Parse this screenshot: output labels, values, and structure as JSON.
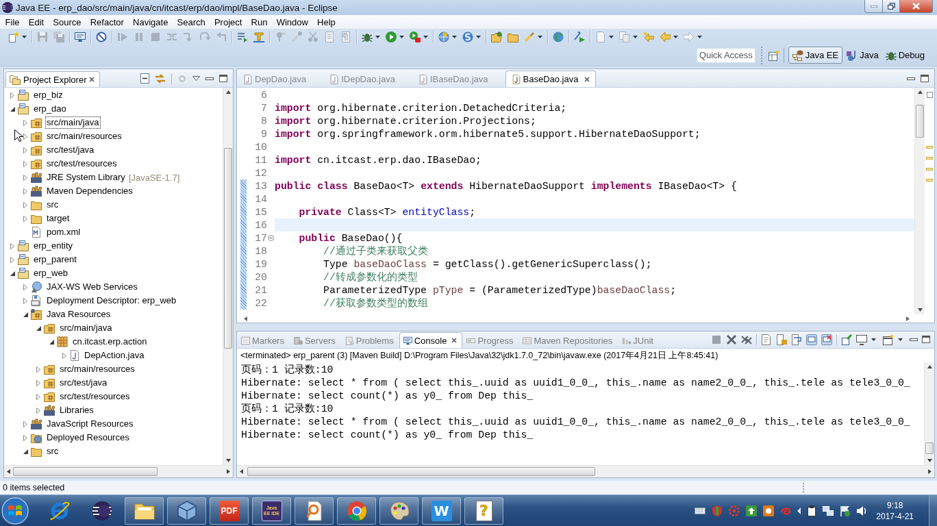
{
  "window": {
    "title": "Java EE - erp_dao/src/main/java/cn/itcast/erp/dao/impl/BaseDao.java - Eclipse"
  },
  "menu": [
    "File",
    "Edit",
    "Source",
    "Refactor",
    "Navigate",
    "Search",
    "Project",
    "Run",
    "Window",
    "Help"
  ],
  "quick_access": {
    "placeholder": "Quick Access"
  },
  "perspectives": [
    {
      "label": "Java EE",
      "kind": "javaee",
      "selected": true
    },
    {
      "label": "Java",
      "kind": "java",
      "selected": false
    },
    {
      "label": "Debug",
      "kind": "debug",
      "selected": false
    }
  ],
  "project_explorer": {
    "title": "Project Explorer",
    "items": [
      {
        "label": "erp_biz",
        "kind": "project",
        "expanded": false,
        "focused": false
      },
      {
        "label": "erp_dao",
        "kind": "project",
        "expanded": true,
        "focused": false,
        "children": [
          {
            "label": "src/main/java",
            "kind": "source_folder",
            "expanded": false,
            "focused": true
          },
          {
            "label": "src/main/resources",
            "kind": "source_folder",
            "expanded": false,
            "focused": false
          },
          {
            "label": "src/test/java",
            "kind": "source_folder",
            "expanded": false,
            "focused": false
          },
          {
            "label": "src/test/resources",
            "kind": "source_folder",
            "expanded": false,
            "focused": false
          },
          {
            "label": "JRE System Library",
            "decoration": "[JavaSE-1.7]",
            "kind": "library",
            "expanded": false,
            "focused": false
          },
          {
            "label": "Maven Dependencies",
            "kind": "library",
            "expanded": false,
            "focused": false
          },
          {
            "label": "src",
            "kind": "folder",
            "expanded": false,
            "focused": false
          },
          {
            "label": "target",
            "kind": "folder",
            "expanded": false,
            "focused": false
          },
          {
            "label": "pom.xml",
            "kind": "xml_file",
            "focused": false
          }
        ]
      },
      {
        "label": "erp_entity",
        "kind": "project",
        "expanded": false,
        "focused": false
      },
      {
        "label": "erp_parent",
        "kind": "project",
        "expanded": false,
        "focused": false
      },
      {
        "label": "erp_web",
        "kind": "project",
        "expanded": true,
        "focused": false,
        "children": [
          {
            "label": "JAX-WS Web Services",
            "kind": "web_services",
            "expanded": false,
            "focused": false
          },
          {
            "label": "Deployment Descriptor: erp_web",
            "kind": "descriptor",
            "expanded": false,
            "focused": false
          },
          {
            "label": "Java Resources",
            "kind": "java_resources",
            "expanded": true,
            "focused": false,
            "children": [
              {
                "label": "src/main/java",
                "kind": "source_folder",
                "expanded": true,
                "focused": false,
                "children": [
                  {
                    "label": "cn.itcast.erp.action",
                    "kind": "package",
                    "expanded": true,
                    "focused": false,
                    "children": [
                      {
                        "label": "DepAction.java",
                        "kind": "java_file",
                        "expanded": false,
                        "focused": false
                      }
                    ]
                  }
                ]
              },
              {
                "label": "src/main/resources",
                "kind": "source_folder",
                "expanded": false,
                "focused": false
              },
              {
                "label": "src/test/java",
                "kind": "source_folder",
                "expanded": false,
                "focused": false
              },
              {
                "label": "src/test/resources",
                "kind": "source_folder",
                "expanded": false,
                "focused": false
              },
              {
                "label": "Libraries",
                "kind": "library",
                "expanded": false,
                "focused": false
              }
            ]
          },
          {
            "label": "JavaScript Resources",
            "kind": "library",
            "expanded": false,
            "focused": false
          },
          {
            "label": "Deployed Resources",
            "kind": "deployed_resources",
            "expanded": false,
            "focused": false
          },
          {
            "label": "src",
            "kind": "folder",
            "expanded": true,
            "focused": false
          }
        ]
      }
    ]
  },
  "editor": {
    "tabs": [
      {
        "label": "DepDao.java",
        "selected": false
      },
      {
        "label": "IDepDao.java",
        "selected": false
      },
      {
        "label": "IBaseDao.java",
        "selected": false
      },
      {
        "label": "BaseDao.java",
        "selected": true
      }
    ],
    "lines": [
      {
        "number": "6",
        "changed": false,
        "current": false,
        "fold": false
      },
      {
        "number": "7",
        "changed": false,
        "current": false,
        "fold": false,
        "tokens": [
          {
            "text": "import",
            "kind": "keyword"
          },
          {
            "text": " org.hibernate.criterion.DetachedCriteria;",
            "kind": "plain"
          }
        ]
      },
      {
        "number": "8",
        "changed": false,
        "current": false,
        "fold": false,
        "tokens": [
          {
            "text": "import",
            "kind": "keyword"
          },
          {
            "text": " org.hibernate.criterion.Projections;",
            "kind": "plain"
          }
        ]
      },
      {
        "number": "9",
        "changed": false,
        "current": false,
        "fold": false,
        "tokens": [
          {
            "text": "import",
            "kind": "keyword"
          },
          {
            "text": " org.springframework.orm.hibernate5.support.HibernateDaoSupport;",
            "kind": "plain"
          }
        ]
      },
      {
        "number": "10",
        "changed": false,
        "current": false,
        "fold": false
      },
      {
        "number": "11",
        "changed": false,
        "current": false,
        "fold": false,
        "tokens": [
          {
            "text": "import",
            "kind": "keyword"
          },
          {
            "text": " cn.itcast.erp.dao.IBaseDao;",
            "kind": "plain"
          }
        ]
      },
      {
        "number": "12",
        "changed": false,
        "current": false,
        "fold": false
      },
      {
        "number": "13",
        "changed": true,
        "current": false,
        "fold": false,
        "tokens": [
          {
            "text": "public class",
            "kind": "keyword"
          },
          {
            "text": " BaseDao<T> ",
            "kind": "plain"
          },
          {
            "text": "extends",
            "kind": "keyword"
          },
          {
            "text": " HibernateDaoSupport ",
            "kind": "plain"
          },
          {
            "text": "implements",
            "kind": "keyword"
          },
          {
            "text": " IBaseDao<T> {",
            "kind": "plain"
          }
        ]
      },
      {
        "number": "14",
        "changed": true,
        "current": false,
        "fold": false
      },
      {
        "number": "15",
        "changed": true,
        "current": false,
        "fold": false,
        "tokens": [
          {
            "text": "    private",
            "kind": "keyword"
          },
          {
            "text": " Class<T> ",
            "kind": "plain"
          },
          {
            "text": "entityClass",
            "kind": "field"
          },
          {
            "text": ";",
            "kind": "plain"
          }
        ]
      },
      {
        "number": "16",
        "changed": true,
        "current": true,
        "fold": false
      },
      {
        "number": "17",
        "changed": true,
        "current": false,
        "fold": true,
        "tokens": [
          {
            "text": "    public",
            "kind": "keyword"
          },
          {
            "text": " BaseDao(){",
            "kind": "plain"
          }
        ]
      },
      {
        "number": "18",
        "changed": true,
        "current": false,
        "fold": false,
        "tokens": [
          {
            "text": "        //通过子类来获取父类",
            "kind": "comment"
          }
        ]
      },
      {
        "number": "19",
        "changed": true,
        "current": false,
        "fold": false,
        "tokens": [
          {
            "text": "        Type ",
            "kind": "plain"
          },
          {
            "text": "baseDaoClass",
            "kind": "variable"
          },
          {
            "text": " = getClass().getGenericSuperclass();",
            "kind": "plain"
          }
        ]
      },
      {
        "number": "20",
        "changed": true,
        "current": false,
        "fold": false,
        "tokens": [
          {
            "text": "        //转成参数化的类型",
            "kind": "comment"
          }
        ]
      },
      {
        "number": "21",
        "changed": true,
        "current": false,
        "fold": false,
        "tokens": [
          {
            "text": "        ParameterizedType ",
            "kind": "plain"
          },
          {
            "text": "pType",
            "kind": "variable"
          },
          {
            "text": " = (ParameterizedType)",
            "kind": "plain"
          },
          {
            "text": "baseDaoClass",
            "kind": "variable"
          },
          {
            "text": ";",
            "kind": "plain"
          }
        ]
      },
      {
        "number": "22",
        "changed": true,
        "current": false,
        "fold": false,
        "tokens": [
          {
            "text": "        //获取参数类型的数组",
            "kind": "comment"
          }
        ]
      }
    ]
  },
  "console_view": {
    "tabs": [
      {
        "label": "Markers",
        "kind": "markers",
        "selected": false
      },
      {
        "label": "Servers",
        "kind": "servers",
        "selected": false
      },
      {
        "label": "Problems",
        "kind": "problems",
        "selected": false
      },
      {
        "label": "Console",
        "kind": "console",
        "selected": true
      },
      {
        "label": "Progress",
        "kind": "progress",
        "selected": false
      },
      {
        "label": "Maven Repositories",
        "kind": "repositories",
        "selected": false
      },
      {
        "label": "JUnit",
        "kind": "junit",
        "selected": false
      }
    ],
    "process": "<terminated> erp_parent (3) [Maven Build] D:\\Program Files\\Java\\32\\jdk1.7.0_72\\bin\\javaw.exe (2017年4月21日 上午8:45:41)",
    "lines": [
      "页码：1 记录数:10",
      "Hibernate: select * from ( select this_.uuid as uuid1_0_0_, this_.name as name2_0_0_, this_.tele as tele3_0_0_",
      "Hibernate: select count(*) as y0_ from Dep this_",
      "页码：1 记录数:10",
      "Hibernate: select * from ( select this_.uuid as uuid1_0_0_, this_.name as name2_0_0_, this_.tele as tele3_0_0_",
      "Hibernate: select count(*) as y0_ from Dep this_"
    ]
  },
  "status_bar": {
    "text": "0 items selected"
  },
  "taskbar": {
    "apps": [
      {
        "kind": "ie",
        "running": false
      },
      {
        "kind": "eclipse",
        "running": false
      },
      {
        "kind": "folder",
        "running": true
      },
      {
        "kind": "virtualbox",
        "running": true
      },
      {
        "kind": "pdf",
        "label": "PDF",
        "running": true
      },
      {
        "kind": "ide",
        "label": "Java EE IDE",
        "running": true
      },
      {
        "kind": "viewer",
        "running": true
      },
      {
        "kind": "chrome",
        "running": true
      },
      {
        "kind": "paint",
        "running": true
      },
      {
        "kind": "wps",
        "label": "W",
        "running": true
      },
      {
        "kind": "help",
        "label": "?",
        "running": true
      }
    ],
    "clock": {
      "time": "9:18",
      "date": "2017-4-21"
    }
  }
}
